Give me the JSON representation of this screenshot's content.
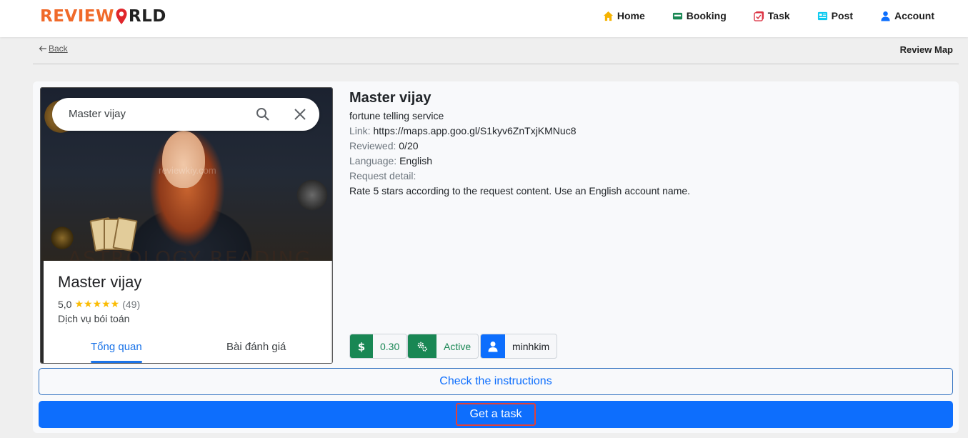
{
  "brand": {
    "part1": "REVIEW",
    "part2": "RLD"
  },
  "nav": [
    {
      "label": "Home",
      "icon": "house-icon",
      "color": "#f5b301"
    },
    {
      "label": "Booking",
      "icon": "ticket-icon",
      "color": "#198754"
    },
    {
      "label": "Task",
      "icon": "task-icon",
      "color": "#dc3545"
    },
    {
      "label": "Post",
      "icon": "newspaper-icon",
      "color": "#0dcaf0"
    },
    {
      "label": "Account",
      "icon": "person-icon",
      "color": "#0d6efd"
    }
  ],
  "subbar": {
    "back_label": "Back",
    "page_label": "Review Map"
  },
  "thumb": {
    "search_query": "Master vijay",
    "watermark": "reviewkiy.com",
    "bottom_text": "ASTROLOGY READING",
    "title": "Master vijay",
    "rating": "5,0",
    "stars": "★★★★★",
    "count": "(49)",
    "category": "Dịch vụ bói toán",
    "tab_overview": "Tổng quan",
    "tab_reviews": "Bài đánh giá"
  },
  "detail": {
    "title": "Master vijay",
    "subtitle": "fortune telling service",
    "link_key": "Link:",
    "link_val": "https://maps.app.goo.gl/S1kyv6ZnTxjKMNuc8",
    "reviewed_key": "Reviewed:",
    "reviewed_val": "0/20",
    "language_key": "Language:",
    "language_val": "English",
    "request_key": "Request detail:",
    "request_val": "Rate 5 stars according to the request content. Use an English account name."
  },
  "badges": {
    "price": "0.30",
    "status": "Active",
    "user": "minhkim"
  },
  "buttons": {
    "instructions": "Check the instructions",
    "get_task": "Get a task"
  }
}
